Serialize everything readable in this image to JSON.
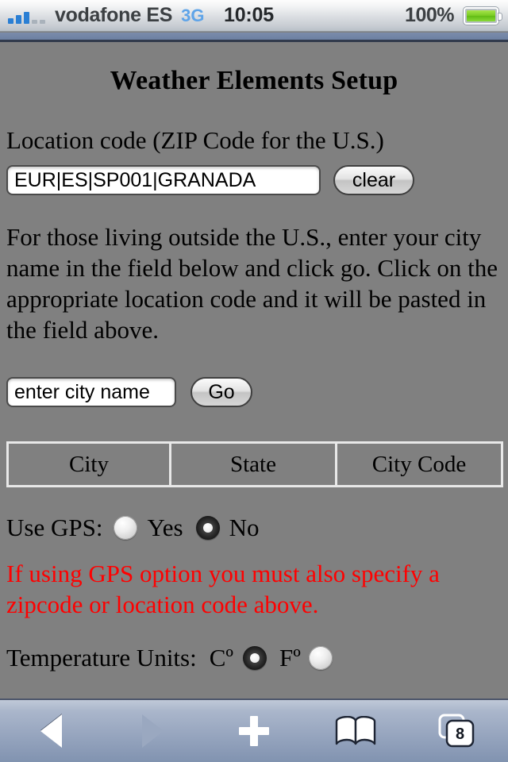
{
  "status_bar": {
    "signal_icon": "signal-bars-icon",
    "signal_bars_filled": 3,
    "signal_bars_empty": 2,
    "carrier": "vodafone",
    "carrier_country": "ES",
    "carrier_label": "vodafone ES",
    "network_type": "3G",
    "time": "10:05",
    "battery_percent": "100%",
    "battery_icon": "battery-full-icon",
    "accent_blue": "#2a7fd4",
    "battery_green": "#78cc22"
  },
  "page": {
    "title": "Weather Elements Setup",
    "location_label": "Location code (ZIP Code for the U.S.)",
    "location_input_value": "EUR|ES|SP001|GRANADA",
    "location_input_placeholder": "",
    "clear_label": "clear",
    "intro_paragraph": "For those living outside the U.S., enter your city name in the field below and click go. Click on the appropriate location code and it will be pasted in the field above.",
    "city_input_value": "enter city name",
    "city_input_placeholder": "enter city name",
    "go_label": "Go",
    "table": {
      "headers": [
        "City",
        "State",
        "City Code"
      ],
      "rows": []
    },
    "gps": {
      "label": "Use GPS:",
      "yes_label": "Yes",
      "no_label": "No",
      "selected": "No",
      "warning": "If using GPS option you must also specify a zipcode or location code above.",
      "warning_color": "#ff0000"
    },
    "temperature": {
      "label": "Temperature Units:",
      "celsius_label": "Cº",
      "fahrenheit_label": "Fº",
      "selected": "Cº"
    }
  },
  "toolbar": {
    "back_icon": "back-arrow-icon",
    "forward_icon": "forward-arrow-icon",
    "add_icon": "plus-icon",
    "bookmarks_icon": "open-book-icon",
    "tabs_icon": "tabs-stack-icon",
    "tabs_count": "8"
  }
}
